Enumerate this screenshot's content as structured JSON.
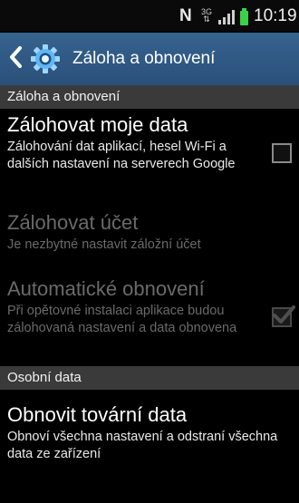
{
  "status_bar": {
    "nfc_label": "N",
    "network_label": "3G",
    "time": "10:19",
    "battery_color": "#3dd14a"
  },
  "action_bar": {
    "title": "Záloha a obnovení",
    "back_icon": "chevron-left",
    "settings_icon": "gear",
    "background": "#2f5b87"
  },
  "sections": {
    "backup_restore": {
      "header": "Záloha a obnovení",
      "backup_data": {
        "title": "Zálohovat moje data",
        "subtitle": "Zálohování dat aplikací, hesel Wi-Fi a dalších nastavení na serverech Google",
        "checked": false
      },
      "backup_account": {
        "title": "Zálohovat účet",
        "subtitle": "Je nezbytné nastavit záložní účet",
        "enabled": false
      },
      "auto_restore": {
        "title": "Automatické obnovení",
        "subtitle": "Při opětovné instalaci aplikace budou zálohovaná nastavení a data obnovena",
        "checked": true,
        "enabled": false
      }
    },
    "personal_data": {
      "header": "Osobní data",
      "factory_reset": {
        "title": "Obnovit tovární data",
        "subtitle": "Obnoví všechna nastavení a odstraní všechna data ze zařízení"
      }
    }
  }
}
